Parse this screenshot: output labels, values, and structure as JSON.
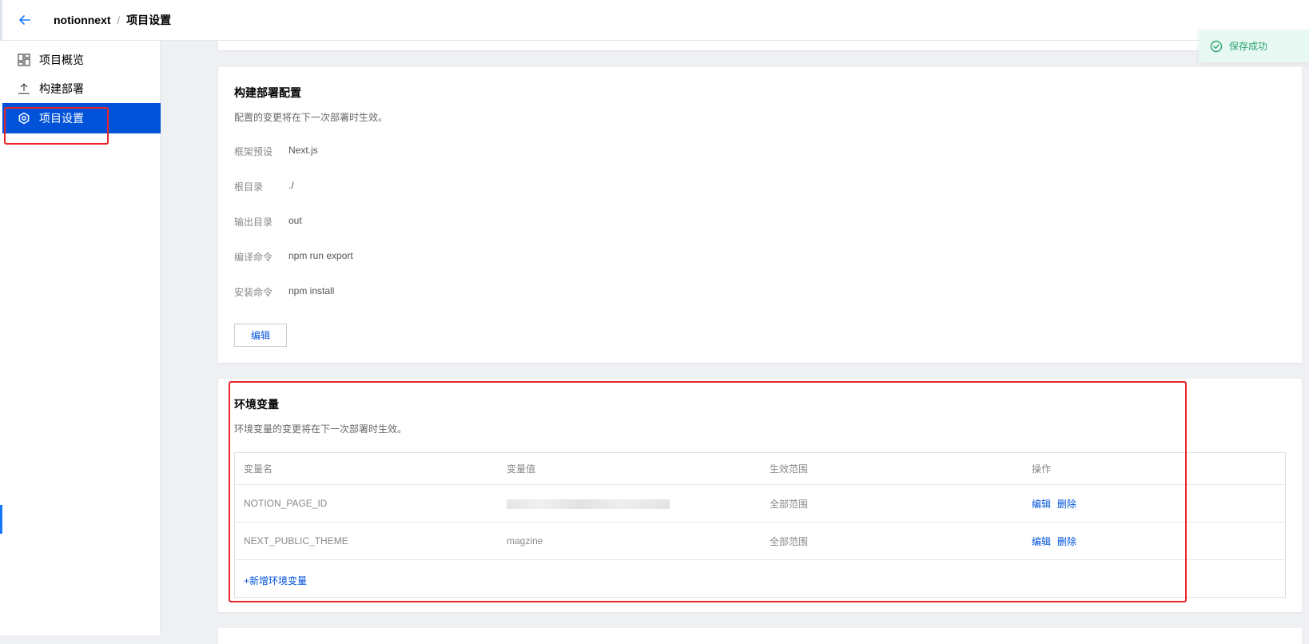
{
  "header": {
    "back_icon": "arrow-left-icon",
    "project_name": "notionnext",
    "separator": "/",
    "current_page": "项目设置"
  },
  "sidebar": {
    "items": [
      {
        "label": "项目概览",
        "icon": "dashboard-icon",
        "active": false
      },
      {
        "label": "构建部署",
        "icon": "upload-icon",
        "active": false
      },
      {
        "label": "项目设置",
        "icon": "settings-icon",
        "active": true
      }
    ]
  },
  "build_config": {
    "title": "构建部署配置",
    "description": "配置的变更将在下一次部署时生效。",
    "fields": [
      {
        "label": "框架预设",
        "value": "Next.js"
      },
      {
        "label": "根目录",
        "value": "./"
      },
      {
        "label": "输出目录",
        "value": "out"
      },
      {
        "label": "编译命令",
        "value": "npm run export"
      },
      {
        "label": "安装命令",
        "value": "npm install"
      }
    ],
    "edit_button": "编辑"
  },
  "env_vars": {
    "title": "环境变量",
    "description": "环境变量的变更将在下一次部署时生效。",
    "columns": [
      "变量名",
      "变量值",
      "生效范围",
      "操作"
    ],
    "rows": [
      {
        "name": "NOTION_PAGE_ID",
        "value": "",
        "value_masked": true,
        "scope": "全部范围",
        "edit": "编辑",
        "delete": "删除"
      },
      {
        "name": "NEXT_PUBLIC_THEME",
        "value": "magzine",
        "value_masked": false,
        "scope": "全部范围",
        "edit": "编辑",
        "delete": "删除"
      }
    ],
    "add_label": "+新增环境变量"
  },
  "toast": {
    "message": "保存成功",
    "icon": "check-circle-icon",
    "color": "#2ba471"
  },
  "colors": {
    "primary": "#0052d9",
    "highlight": "#e8262b",
    "success": "#2ba471"
  }
}
